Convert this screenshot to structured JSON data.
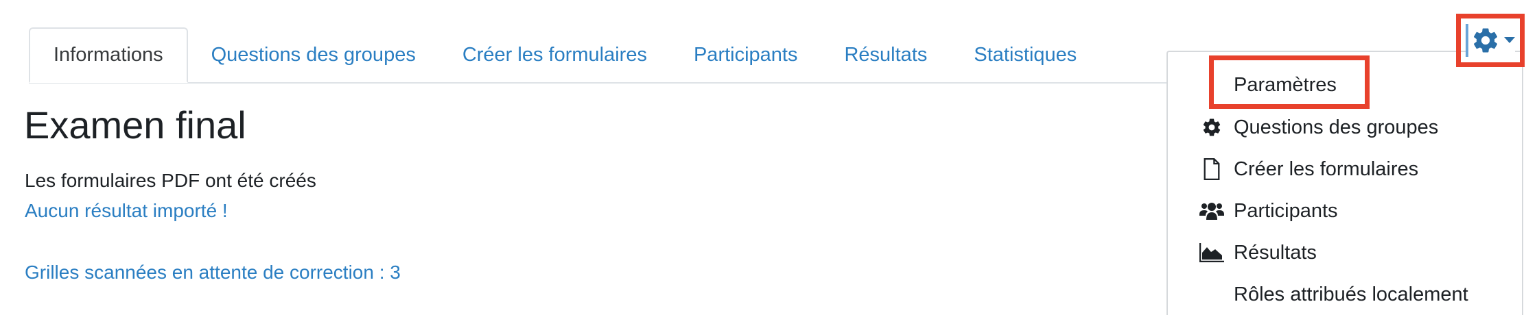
{
  "tabs": [
    {
      "label": "Informations",
      "active": true
    },
    {
      "label": "Questions des groupes",
      "active": false
    },
    {
      "label": "Créer les formulaires",
      "active": false
    },
    {
      "label": "Participants",
      "active": false
    },
    {
      "label": "Résultats",
      "active": false
    },
    {
      "label": "Statistiques",
      "active": false
    }
  ],
  "main": {
    "title": "Examen final",
    "status": "Les formulaires PDF ont été créés",
    "no_results_link": "Aucun résultat importé !",
    "scanned_link": "Grilles scannées en attente de correction : 3"
  },
  "gear_menu": {
    "icon": "gear-icon",
    "caret_icon": "caret-down-icon",
    "items": [
      {
        "label": "Paramètres",
        "icon": "",
        "highlighted": true
      },
      {
        "label": "Questions des groupes",
        "icon": "gear-icon"
      },
      {
        "label": "Créer les formulaires",
        "icon": "file-icon"
      },
      {
        "label": "Participants",
        "icon": "users-icon"
      },
      {
        "label": "Résultats",
        "icon": "area-chart-icon"
      },
      {
        "label": "Rôles attribués localement",
        "icon": ""
      }
    ]
  },
  "colors": {
    "link": "#2a7ec2",
    "highlight": "#e8412c",
    "text": "#1d2125",
    "gear": "#2a6fa8",
    "border": "#dee2e6"
  }
}
